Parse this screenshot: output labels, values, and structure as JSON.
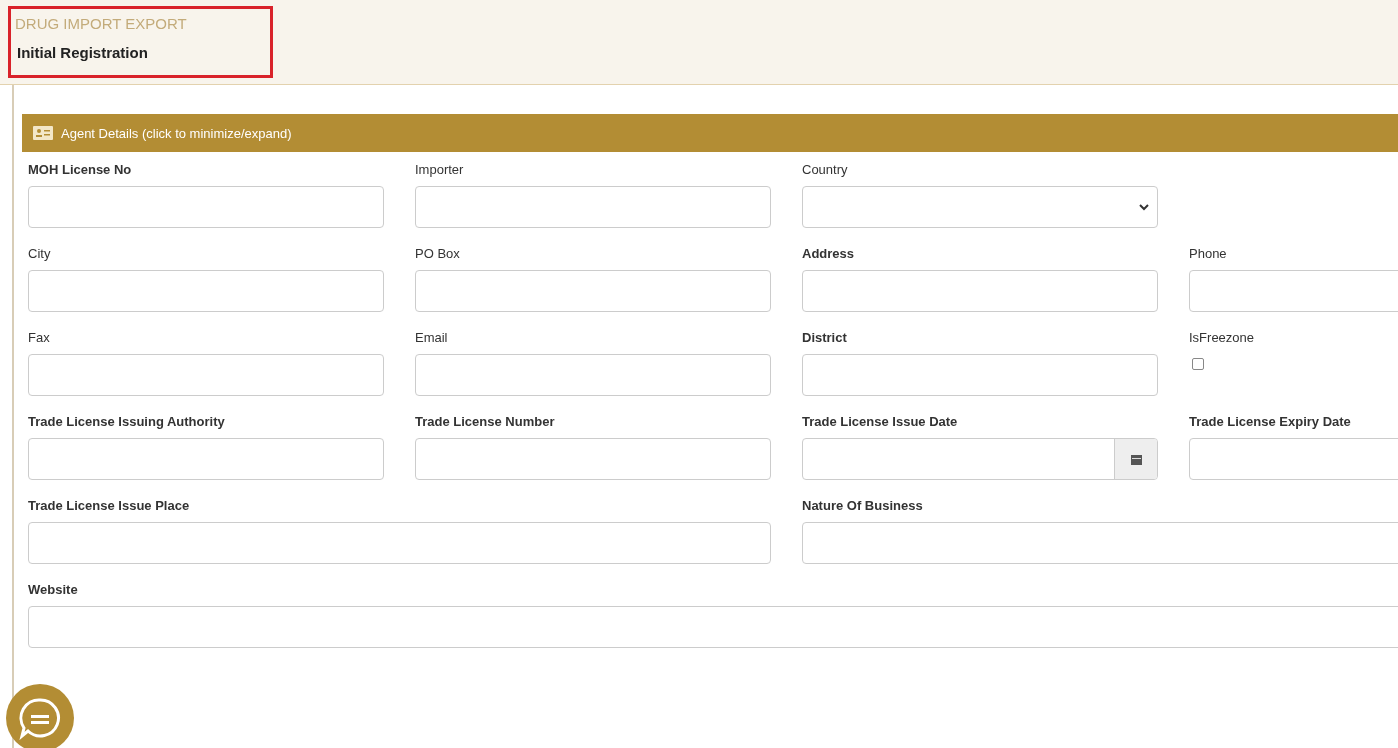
{
  "header": {
    "module": "DRUG IMPORT EXPORT",
    "page_title": "Initial Registration"
  },
  "section": {
    "title": "Agent Details (click to minimize/expand)"
  },
  "rows": [
    [
      {
        "label": "MOH License No",
        "kind": "text",
        "bold": true
      },
      {
        "label": "Importer",
        "kind": "text",
        "bold": false
      },
      {
        "label": "Country",
        "kind": "select",
        "bold": false
      }
    ],
    [
      {
        "label": "City",
        "kind": "text",
        "bold": false
      },
      {
        "label": "PO Box",
        "kind": "text",
        "bold": false
      },
      {
        "label": "Address",
        "kind": "text",
        "bold": true
      },
      {
        "label": "Phone",
        "kind": "text",
        "bold": false
      }
    ],
    [
      {
        "label": "Fax",
        "kind": "text",
        "bold": false
      },
      {
        "label": "Email",
        "kind": "text",
        "bold": false
      },
      {
        "label": "District",
        "kind": "text",
        "bold": true
      },
      {
        "label": "IsFreezone",
        "kind": "checkbox",
        "bold": false,
        "checked": false
      }
    ],
    [
      {
        "label": "Trade License Issuing Authority",
        "kind": "text",
        "bold": true
      },
      {
        "label": "Trade License Number",
        "kind": "text",
        "bold": true
      },
      {
        "label": "Trade License Issue Date",
        "kind": "date",
        "bold": true
      },
      {
        "label": "Trade License Expiry Date",
        "kind": "text",
        "bold": true
      }
    ],
    [
      {
        "label": "Trade License Issue Place",
        "kind": "text",
        "bold": true
      },
      {
        "label": "Nature Of Business",
        "kind": "text",
        "bold": true
      }
    ],
    [
      {
        "label": "Website",
        "kind": "text",
        "bold": true
      }
    ]
  ]
}
